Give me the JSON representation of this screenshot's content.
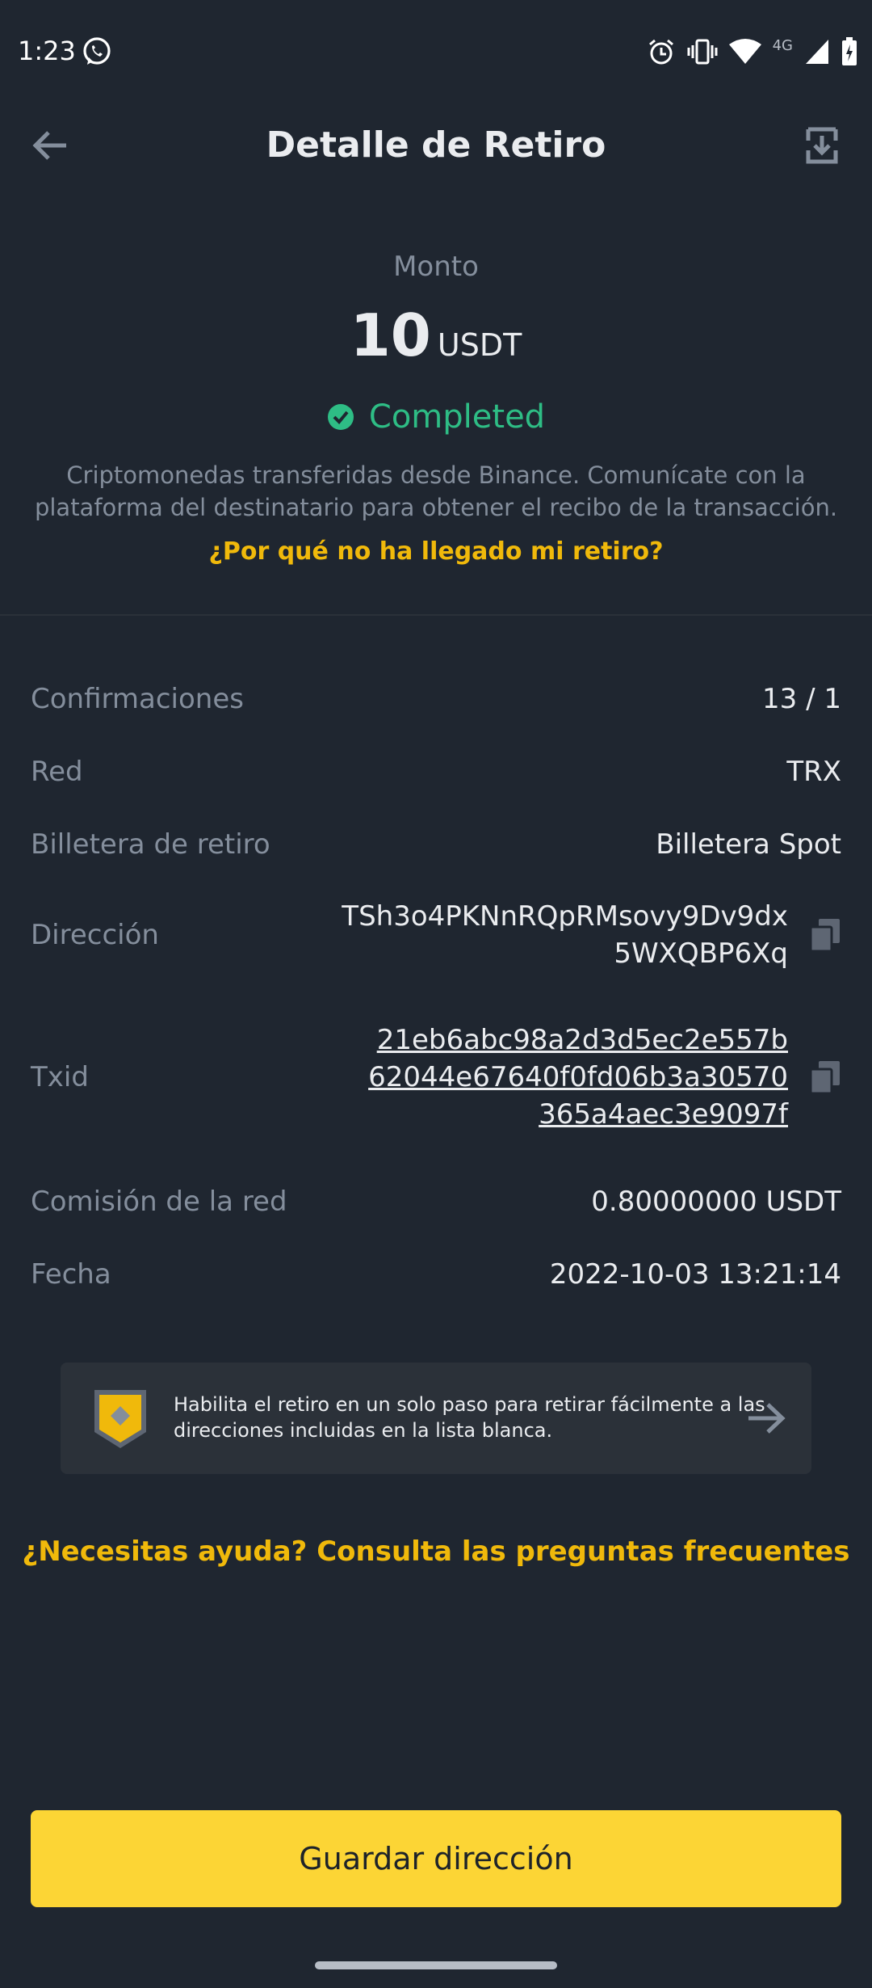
{
  "status_bar": {
    "time": "1:23",
    "network": "4G",
    "icons": [
      "whatsapp-icon",
      "alarm-icon",
      "vibrate-icon",
      "wifi-icon",
      "signal-icon",
      "battery-icon"
    ]
  },
  "header": {
    "title": "Detalle de Retiro",
    "back_icon": "arrow-left-icon",
    "action_icon": "save-image-icon"
  },
  "amount": {
    "label": "Monto",
    "value": "10",
    "unit": "USDT",
    "status": "Completed",
    "status_color": "#2ebd85",
    "description": "Criptomonedas transferidas desde Binance. Comunícate con la plataforma del destinatario para obtener el recibo de la transacción.",
    "why_link": "¿Por qué no ha llegado mi retiro?"
  },
  "details": {
    "confirmations": {
      "label": "Confirmaciones",
      "value": "13 / 1"
    },
    "network": {
      "label": "Red",
      "value": "TRX"
    },
    "wallet": {
      "label": "Billetera de retiro",
      "value": "Billetera Spot"
    },
    "address": {
      "label": "Dirección",
      "value": "TSh3o4PKNnRQpRMsovy9Dv9dx5WXQBP6Xq"
    },
    "txid": {
      "label": "Txid",
      "value": "21eb6abc98a2d3d5ec2e557b62044e67640f0fd06b3a30570365a4aec3e9097f"
    },
    "fee": {
      "label": "Comisión de la red",
      "value": "0.80000000 USDT"
    },
    "date": {
      "label": "Fecha",
      "value": "2022-10-03 13:21:14"
    }
  },
  "banner": {
    "text": "Habilita el retiro en un solo paso para retirar fácilmente a las direcciones incluidas en la lista blanca."
  },
  "help_link": "¿Necesitas ayuda? Consulta las preguntas frecuentes",
  "primary_button": "Guardar dirección",
  "colors": {
    "background": "#1f2630",
    "accent": "#f0b90b",
    "button": "#fcd535",
    "success": "#2ebd85",
    "muted": "#848e9c"
  }
}
